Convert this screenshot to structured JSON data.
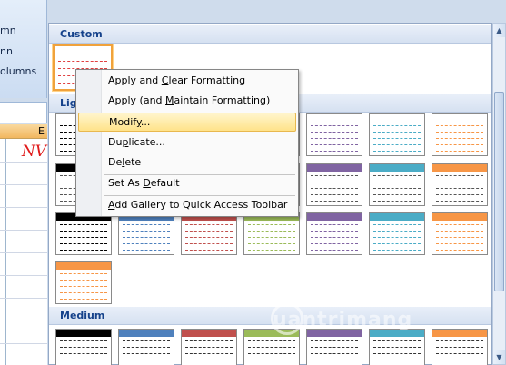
{
  "left_panel": {
    "ribbon_items": [
      "mn",
      "nn",
      "olumns"
    ],
    "column_header": "E",
    "cell_text": "NV"
  },
  "gallery": {
    "sections": [
      "Custom",
      "Light",
      "Medium"
    ],
    "light_header_partial": "Lig"
  },
  "context_menu": {
    "items": [
      {
        "pre": "Apply and ",
        "u": "C",
        "post": "lear Formatting"
      },
      {
        "pre": "Apply (and ",
        "u": "M",
        "post": "aintain Formatting)"
      },
      {
        "pre": "Modif",
        "u": "y",
        "post": "..."
      },
      {
        "pre": "Du",
        "u": "p",
        "post": "licate..."
      },
      {
        "pre": "De",
        "u": "l",
        "post": "ete"
      },
      {
        "pre": "Set As ",
        "u": "D",
        "post": "efault"
      },
      {
        "pre": "",
        "u": "A",
        "post": "dd Gallery to Quick Access Toolbar"
      }
    ]
  },
  "watermark": "uantrimang",
  "colors": {
    "orange": "#f79646",
    "green": "#9bbb59",
    "purple": "#8064a2",
    "teal": "#4bacc6",
    "blue": "#4f81bd",
    "red": "#c0504d",
    "black": "#000000",
    "selected_border": "#f0a23c"
  }
}
